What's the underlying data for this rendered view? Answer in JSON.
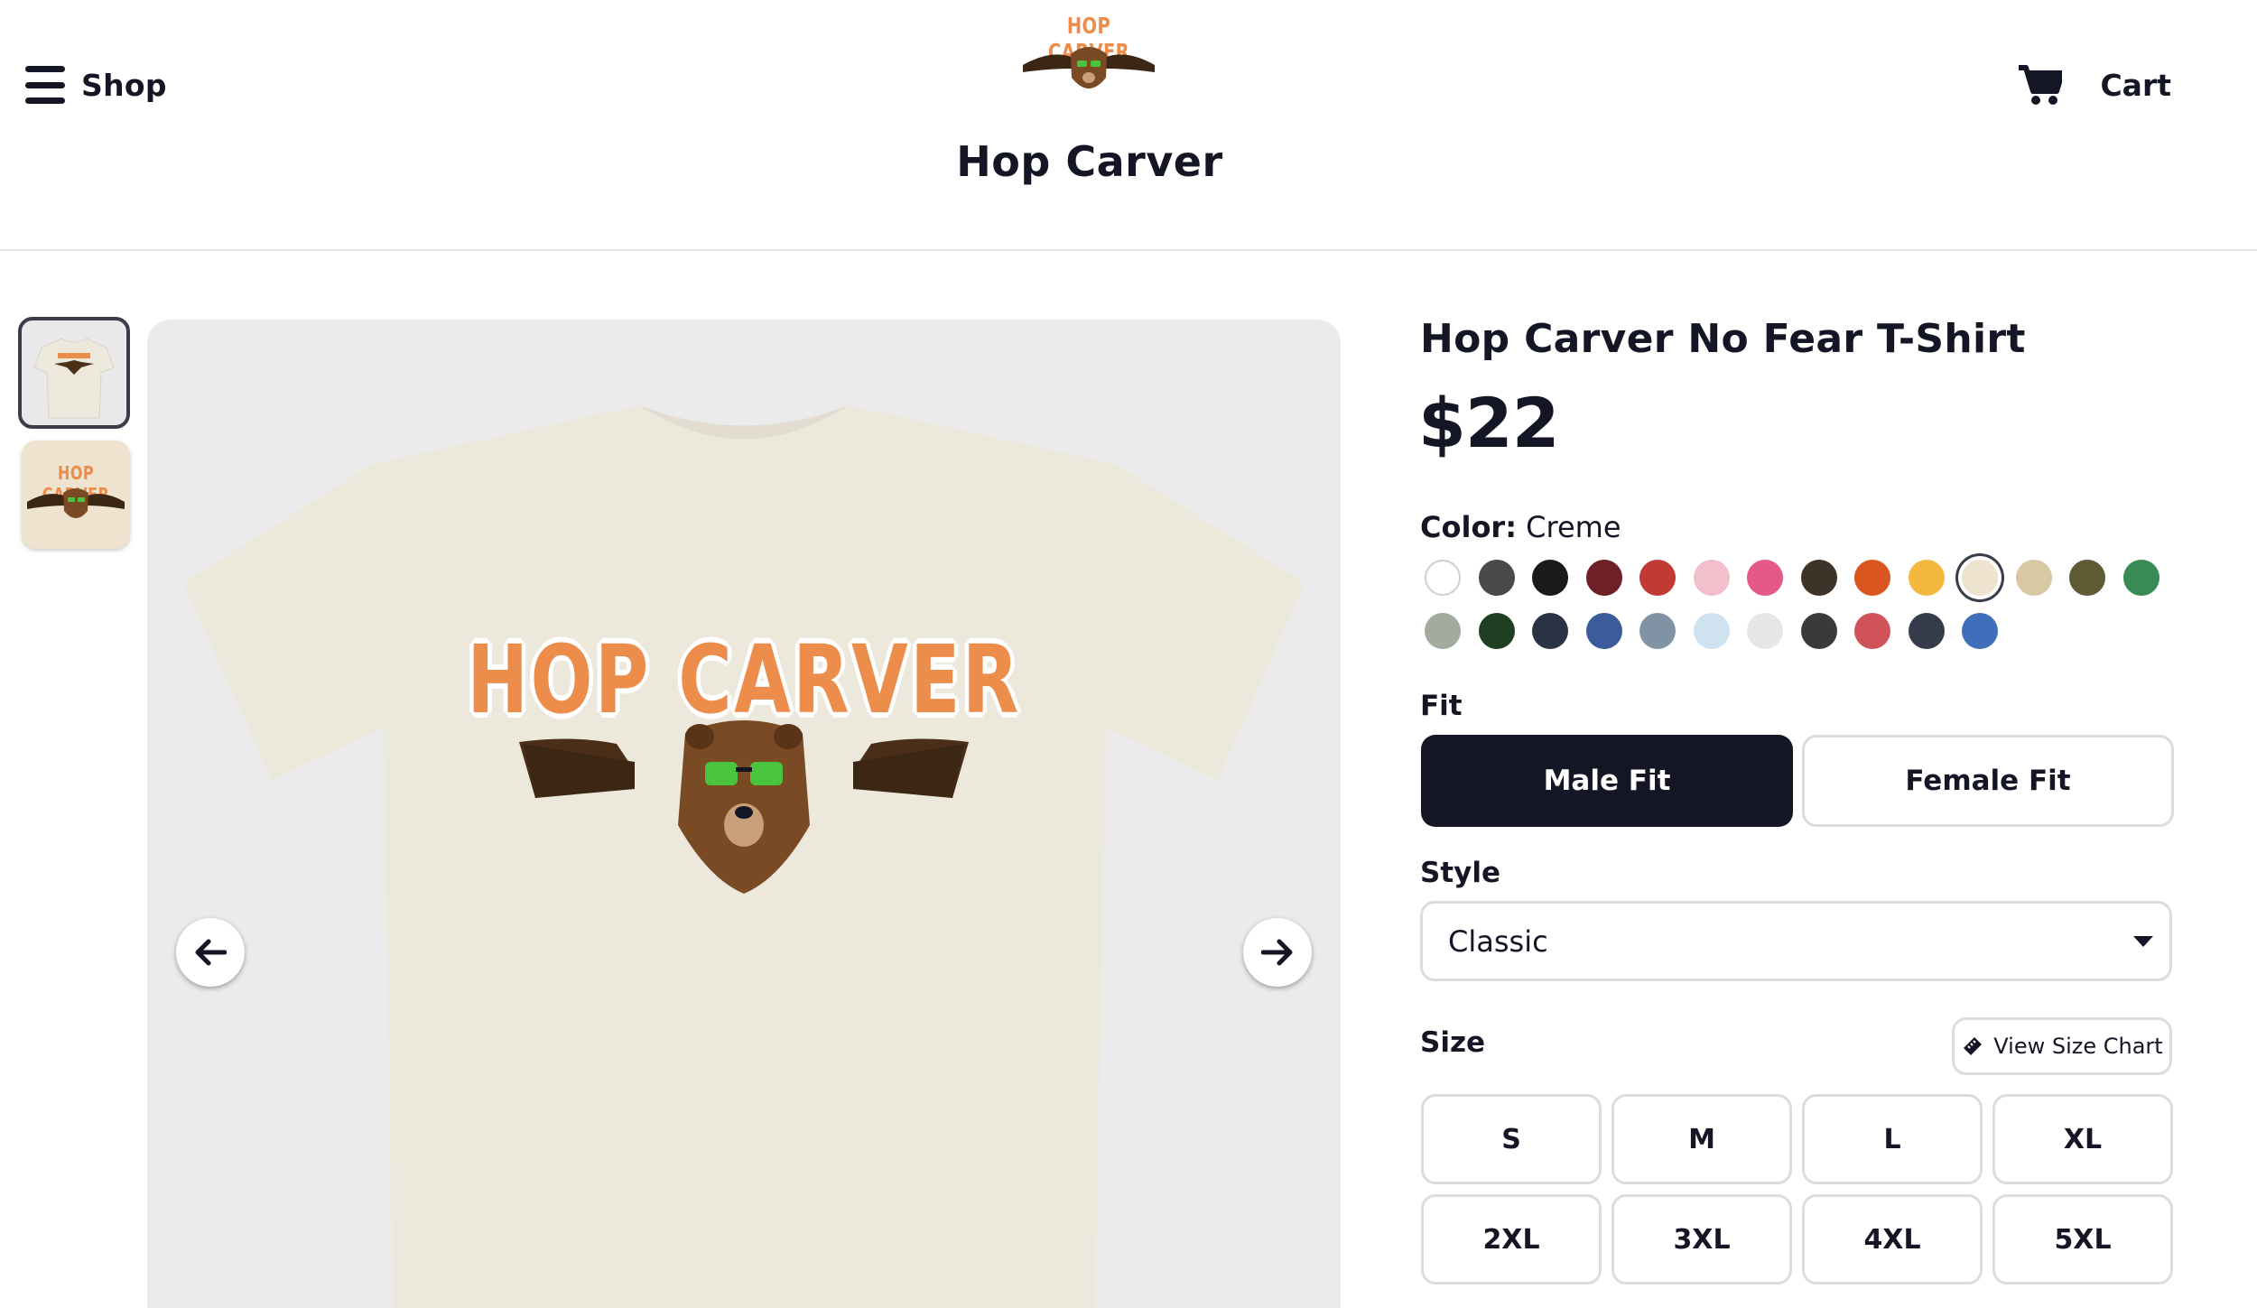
{
  "header": {
    "shop_label": "Shop",
    "cart_label": "Cart",
    "logo_text": "HOP CARVER",
    "store_title": "Hop Carver"
  },
  "gallery": {
    "thumb1_text": "HOP CARVER",
    "thumb2_text": "HOP CARVER",
    "shirt_text": "HOP CARVER",
    "prev_icon": "arrow-left-icon",
    "next_icon": "arrow-right-icon"
  },
  "product": {
    "title": "Hop Carver No Fear T-Shirt",
    "price": "$22",
    "color_label": "Color:",
    "color_value": "Creme",
    "colors": [
      "#ffffff",
      "#4a4a4a",
      "#1a1a1a",
      "#6e2026",
      "#c13a33",
      "#f2bfcc",
      "#e35a8a",
      "#3e3329",
      "#d9561f",
      "#f5b83f",
      "#ede3cf",
      "#d8c8a4",
      "#5e5a34",
      "#3a8a55",
      "#a3ab9f",
      "#1f3f22",
      "#2a3344",
      "#3b5b9a",
      "#7f93a5",
      "#cfe2f0",
      "#e6e6e6",
      "#3a3a3a",
      "#d0535a",
      "#363b4b",
      "#3f6fba"
    ],
    "selected_color_index": 10,
    "fit_label": "Fit",
    "fit_options": [
      "Male Fit",
      "Female Fit"
    ],
    "selected_fit": "Male Fit",
    "style_label": "Style",
    "style_value": "Classic",
    "size_label": "Size",
    "size_chart_label": "View Size Chart",
    "sizes": [
      "S",
      "M",
      "L",
      "XL",
      "2XL",
      "3XL",
      "4XL",
      "5XL"
    ]
  }
}
